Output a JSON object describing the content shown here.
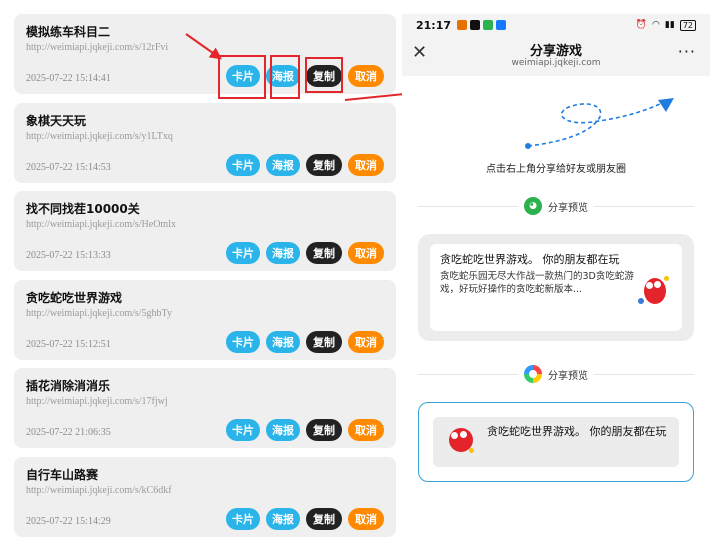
{
  "list": {
    "items": [
      {
        "title": "模拟练车科目二",
        "url": "http://weimiapi.jqkeji.com/s/12rFvi",
        "time": "2025-07-22 15:14:41"
      },
      {
        "title": "象棋天天玩",
        "url": "http://weimiapi.jqkeji.com/s/y1LTxq",
        "time": "2025-07-22 15:14:53"
      },
      {
        "title": "找不同找茬10000关",
        "url": "http://weimiapi.jqkeji.com/s/HeOmlx",
        "time": "2025-07-22 15:13:33"
      },
      {
        "title": "贪吃蛇吃世界游戏",
        "url": "http://weimiapi.jqkeji.com/s/5ghbTy",
        "time": "2025-07-22 15:12:51"
      },
      {
        "title": "插花消除消消乐",
        "url": "http://weimiapi.jqkeji.com/s/17fjwj",
        "time": "2025-07-22 21:06:35"
      },
      {
        "title": "自行车山路赛",
        "url": "http://weimiapi.jqkeji.com/s/kC6dkf",
        "time": "2025-07-22 15:14:29"
      }
    ],
    "buttons": {
      "card": "卡片",
      "poster": "海报",
      "copy": "复制",
      "cancel": "取消"
    }
  },
  "phone": {
    "status": {
      "time": "21:17",
      "battery": "72"
    },
    "nav": {
      "title": "分享游戏",
      "subtitle": "weimiapi.jqkeji.com",
      "close": "✕",
      "more": "···"
    },
    "hint": "点击右上角分享给好友或朋友圈",
    "wechat_label": "分享预览",
    "moments_label": "分享预览",
    "preview1": {
      "title": "贪吃蛇吃世界游戏。 你的朋友都在玩",
      "desc": "贪吃蛇乐园无尽大作战一款热门的3D贪吃蛇游戏，好玩好操作的贪吃蛇新版本..."
    },
    "preview2": {
      "title": "贪吃蛇吃世界游戏。 你的朋友都在玩"
    }
  },
  "colors": {
    "primary": "#2ab4ea",
    "copy": "#222222",
    "cancel": "#ff8a00",
    "highlight": "#e2262b",
    "arrow": "#1f7de0"
  }
}
